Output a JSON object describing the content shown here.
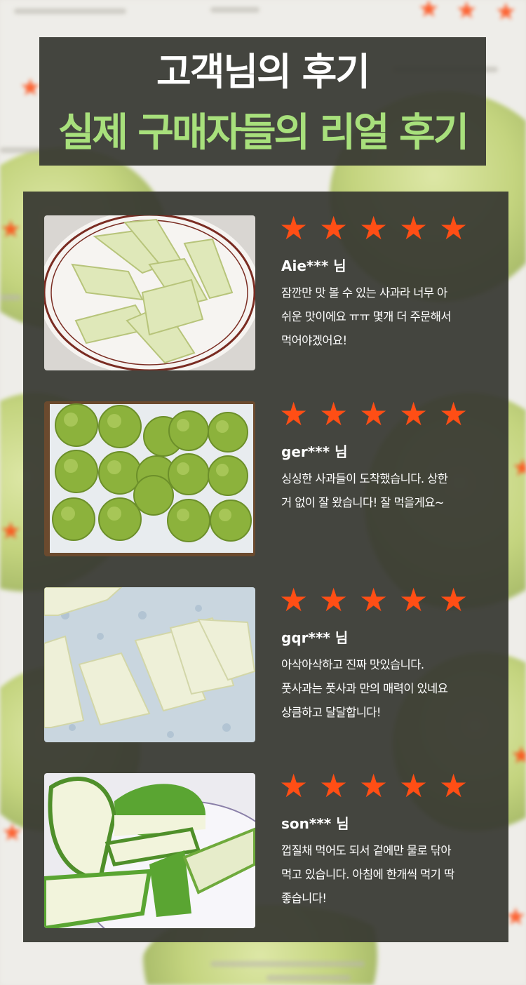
{
  "header": {
    "title_line1": "고객님의 후기",
    "title_line2": "실제 구매자들의 리얼 후기",
    "title_color": "#ffffff",
    "accent_color": "#a8e07c"
  },
  "star_color": "#ff4e15",
  "star_glyph": "★",
  "reviews": [
    {
      "rating": 5,
      "reviewer": "Aie*** 님",
      "text": "잠깐만 맛 볼 수 있는 사과라 너무 아\n쉬운 맛이에요 ㅠㅠ 몇개 더 주문해서\n먹어야겠어요!",
      "photo": "sliced-apples-on-plate"
    },
    {
      "rating": 5,
      "reviewer": "ger*** 님",
      "text": "싱싱한 사과들이 도착했습니다. 상한\n거 없이 잘 왔습니다! 잘 먹을게요~",
      "photo": "green-apples-in-box"
    },
    {
      "rating": 5,
      "reviewer": "gqr*** 님",
      "text": "아삭아삭하고 진짜 맛있습니다.\n풋사과는 풋사과 만의 매력이 있네요\n상큼하고 달달합니다!",
      "photo": "peeled-apple-pieces"
    },
    {
      "rating": 5,
      "reviewer": "son*** 님",
      "text": "껍질채 먹어도 되서 겉에만 물로 닦아\n먹고 있습니다. 아침에 한개씩 먹기 딱\n좋습니다!",
      "photo": "cut-green-apple-wedges"
    }
  ]
}
